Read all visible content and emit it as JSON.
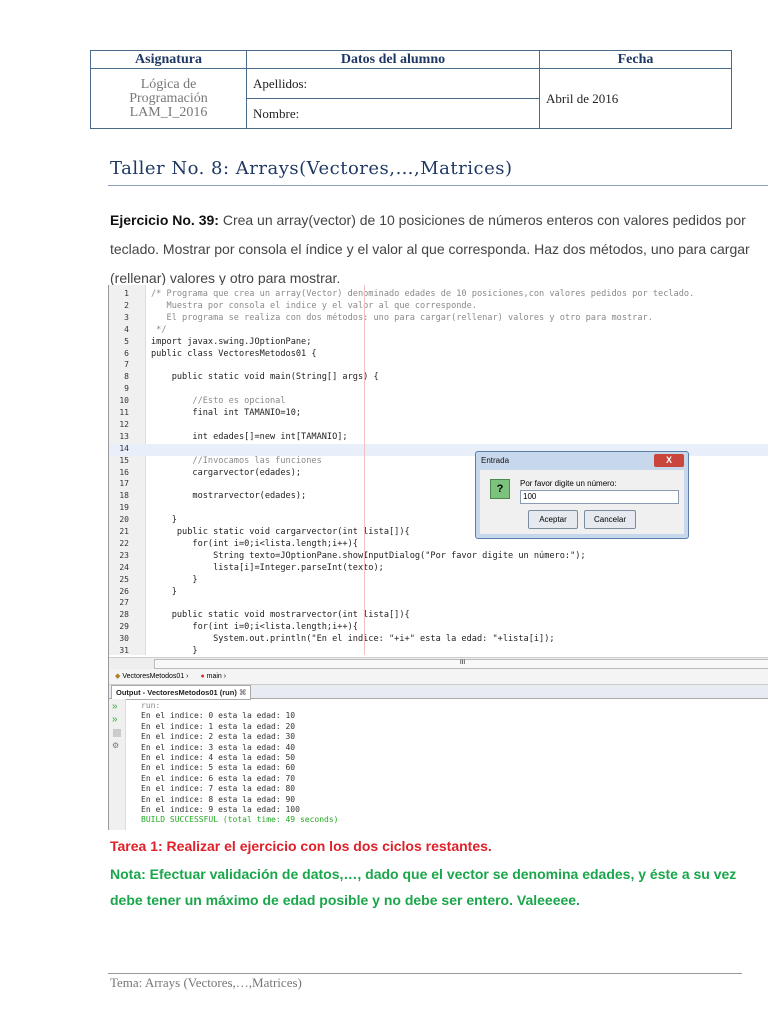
{
  "header": {
    "col_subject": "Asignatura",
    "col_student": "Datos del alumno",
    "col_date": "Fecha",
    "subject_lines": [
      "Lógica de",
      "Programación",
      "LAM_I_2016"
    ],
    "apellidos": "Apellidos:",
    "nombre": "Nombre:",
    "date": "Abril de 2016"
  },
  "title": "Taller No. 8: Arrays(Vectores,…,Matrices)",
  "exercise": {
    "label": "Ejercicio No. 39:",
    "text": " Crea un array(vector) de 10 posiciones de números enteros con valores pedidos por teclado. Mostrar por consola el índice y el valor al que corresponda. Haz dos métodos, uno para cargar (rellenar) valores y otro para mostrar."
  },
  "code": [
    {
      "n": "1",
      "t": "/* Programa que crea un array(Vector) denominado edades de 10 posiciones,con valores pedidos por teclado.",
      "k": "cm"
    },
    {
      "n": "2",
      "t": "   Muestra por consola el indice y el valor al que corresponde.",
      "k": "cm"
    },
    {
      "n": "3",
      "t": "   El programa se realiza con dos métodos: uno para cargar(rellenar) valores y otro para mostrar.",
      "k": "cm"
    },
    {
      "n": "4",
      "t": " */",
      "k": "cm"
    },
    {
      "n": "5",
      "t": "import javax.swing.JOptionPane;",
      "k": ""
    },
    {
      "n": "6",
      "t": "public class VectoresMetodos01 {",
      "k": ""
    },
    {
      "n": "7",
      "t": "",
      "k": ""
    },
    {
      "n": "8",
      "t": "    public static void main(String[] args) {",
      "k": ""
    },
    {
      "n": "9",
      "t": "",
      "k": ""
    },
    {
      "n": "10",
      "t": "        //Esto es opcional",
      "k": "cm"
    },
    {
      "n": "11",
      "t": "        final int TAMANIO=10;",
      "k": ""
    },
    {
      "n": "12",
      "t": "",
      "k": ""
    },
    {
      "n": "13",
      "t": "        int edades[]=new int[TAMANIO];",
      "k": ""
    },
    {
      "n": "14",
      "t": "",
      "k": "hl"
    },
    {
      "n": "15",
      "t": "        //Invocamos las funciones",
      "k": "cm"
    },
    {
      "n": "16",
      "t": "        cargarvector(edades);",
      "k": ""
    },
    {
      "n": "17",
      "t": "",
      "k": ""
    },
    {
      "n": "18",
      "t": "        mostrarvector(edades);",
      "k": ""
    },
    {
      "n": "19",
      "t": "",
      "k": ""
    },
    {
      "n": "20",
      "t": "    }",
      "k": ""
    },
    {
      "n": "21",
      "t": "     public static void cargarvector(int lista[]){",
      "k": ""
    },
    {
      "n": "22",
      "t": "        for(int i=0;i<lista.length;i++){",
      "k": ""
    },
    {
      "n": "23",
      "t": "            String texto=JOptionPane.showInputDialog(\"Por favor digite un número:\");",
      "k": ""
    },
    {
      "n": "24",
      "t": "            lista[i]=Integer.parseInt(texto);",
      "k": ""
    },
    {
      "n": "25",
      "t": "        }",
      "k": ""
    },
    {
      "n": "26",
      "t": "    }",
      "k": ""
    },
    {
      "n": "27",
      "t": "",
      "k": ""
    },
    {
      "n": "28",
      "t": "    public static void mostrarvector(int lista[]){",
      "k": ""
    },
    {
      "n": "29",
      "t": "        for(int i=0;i<lista.length;i++){",
      "k": ""
    },
    {
      "n": "30",
      "t": "            System.out.println(\"En el indice: \"+i+\" esta la edad: \"+lista[i]);",
      "k": ""
    },
    {
      "n": "31",
      "t": "        }",
      "k": ""
    }
  ],
  "breadcrumb": {
    "class": "VectoresMetodos01",
    "method": "main",
    "scroll_marker": "III"
  },
  "dialog": {
    "title": "Entrada",
    "close": "X",
    "prompt": "Por favor digite un número:",
    "value": "100",
    "ok": "Aceptar",
    "cancel": "Cancelar",
    "icon": "?"
  },
  "output": {
    "tab": "Output - VectoresMetodos01 (run)",
    "tab_close": "⌘",
    "lines": [
      "run:",
      "En el indice: 0 esta la edad: 10",
      "En el indice: 1 esta la edad: 20",
      "En el indice: 2 esta la edad: 30",
      "En el indice: 3 esta la edad: 40",
      "En el indice: 4 esta la edad: 50",
      "En el indice: 5 esta la edad: 60",
      "En el indice: 6 esta la edad: 70",
      "En el indice: 7 esta la edad: 80",
      "En el indice: 8 esta la edad: 90",
      "En el indice: 9 esta la edad: 100"
    ],
    "build": "BUILD SUCCESSFUL (total time: 49 seconds)"
  },
  "task": "Tarea 1: Realizar el ejercicio con los dos ciclos restantes.",
  "note": "Nota: Efectuar validación de datos,…, dado que el vector se denomina edades, y éste a su vez debe tener un máximo de edad posible y no debe ser entero. Valeeeee.",
  "footer": "Tema: Arrays (Vectores,…,Matrices)"
}
